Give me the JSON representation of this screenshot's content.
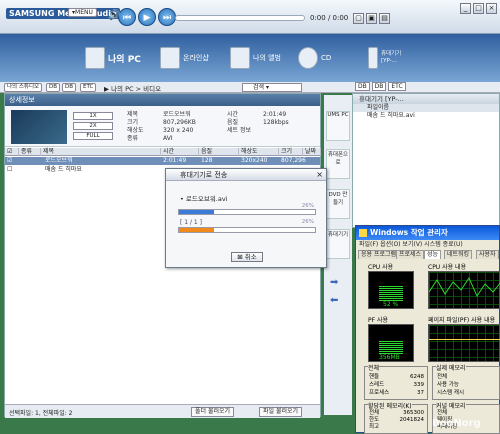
{
  "app": {
    "logo": "SAMSUNG Media Studio",
    "logo_badge": "▾MENU",
    "time": "0:00 / 0:00"
  },
  "nav": [
    {
      "label": "나의 PC"
    },
    {
      "label": "온라인샵"
    },
    {
      "label": "나의 앨범"
    },
    {
      "label": "CD"
    },
    {
      "label": "휴대기기",
      "sub": "[YP-..."
    }
  ],
  "toolbar": {
    "my_studio": "나의 스튜디오",
    "btn1": "DB",
    "btn2": "DB",
    "btn3": "ETC",
    "breadcrumb": "▶ 나의 PC > 비디오",
    "search_placeholder": "검색 ▾"
  },
  "left_panel": {
    "title": "상세정보",
    "zoom": [
      "1X",
      "2X",
      "FULL"
    ],
    "details": [
      {
        "k": "제목",
        "v": "로드오브워"
      },
      {
        "k": "크기",
        "v": "807,296KB"
      },
      {
        "k": "해상도",
        "v": "320 x 240"
      },
      {
        "k": "종류",
        "v": "AVI"
      }
    ],
    "details2": [
      {
        "k": "시간",
        "v": "2:01:49"
      },
      {
        "k": "음질",
        "v": "128kbps"
      },
      {
        "k": "세트 정보",
        "v": ""
      }
    ],
    "columns": [
      "종류",
      "제목",
      "시간",
      "음질",
      "해상도",
      "크기",
      "날짜"
    ],
    "rows": [
      {
        "name": "로드오브워",
        "time": "2:01:49",
        "quality": "128",
        "res": "320x240",
        "size": "807,296",
        "selected": true
      },
      {
        "name": "매솜 드 히마요",
        "time": "",
        "quality": "",
        "res": "",
        "size": "",
        "selected": false
      }
    ],
    "footer_status": "선택파일: 1, 전체파일: 2",
    "footer_btn1": "폴더 불러오기",
    "footer_btn2": "파일 불러오기"
  },
  "side_tabs": [
    "UMS PC",
    "휴대폰으로",
    "DVD 만들기",
    "휴대기기"
  ],
  "right_panel": {
    "title": "휴대기기 [YP-...",
    "column": "파일이름",
    "rows": [
      "매솜 드 히마요.avi"
    ]
  },
  "dialog": {
    "title": "휴대기기로 전송",
    "file": "• 로드오브워.avi",
    "progress1": 26,
    "progress1_label": "26%",
    "count_label": "[ 1 / 1 ]",
    "progress2": 26,
    "progress2_label": "26%",
    "cancel": "취소"
  },
  "taskmgr": {
    "title": "Windows 작업 관리자",
    "menu": "파일(F)  옵션(O)  보기(V)  시스템 종료(U)",
    "tabs": [
      "응용 프로그램",
      "프로세스",
      "성능",
      "네트워킹",
      "사용자"
    ],
    "cpu_usage_label": "CPU 사용",
    "cpu_usage_value": "52 %",
    "cpu_history_label": "CPU 사용 내용",
    "pf_label": "PF 사용",
    "pf_value": "356MB",
    "pf_history_label": "페이지 파일(PF) 사용 내용",
    "total_label": "전체",
    "total_items": [
      {
        "k": "핸들",
        "v": "6248"
      },
      {
        "k": "스레드",
        "v": "339"
      },
      {
        "k": "프로세스",
        "v": "37"
      }
    ],
    "physmem_label": "실제 메모리",
    "physmem_items": [
      {
        "k": "전체"
      },
      {
        "k": "사용 가능"
      },
      {
        "k": "시스템 캐시"
      }
    ],
    "commit_label": "할당된 메모리(K)",
    "commit_items": [
      {
        "k": "전체",
        "v": "365300"
      },
      {
        "k": "한도",
        "v": "2041824"
      },
      {
        "k": "최고",
        "v": ""
      }
    ],
    "kernel_label": "커널 메모리",
    "kernel_items": [
      {
        "k": "전체"
      },
      {
        "k": "페이징"
      },
      {
        "k": "비페이징"
      }
    ]
  },
  "watermark": "BooNorg"
}
